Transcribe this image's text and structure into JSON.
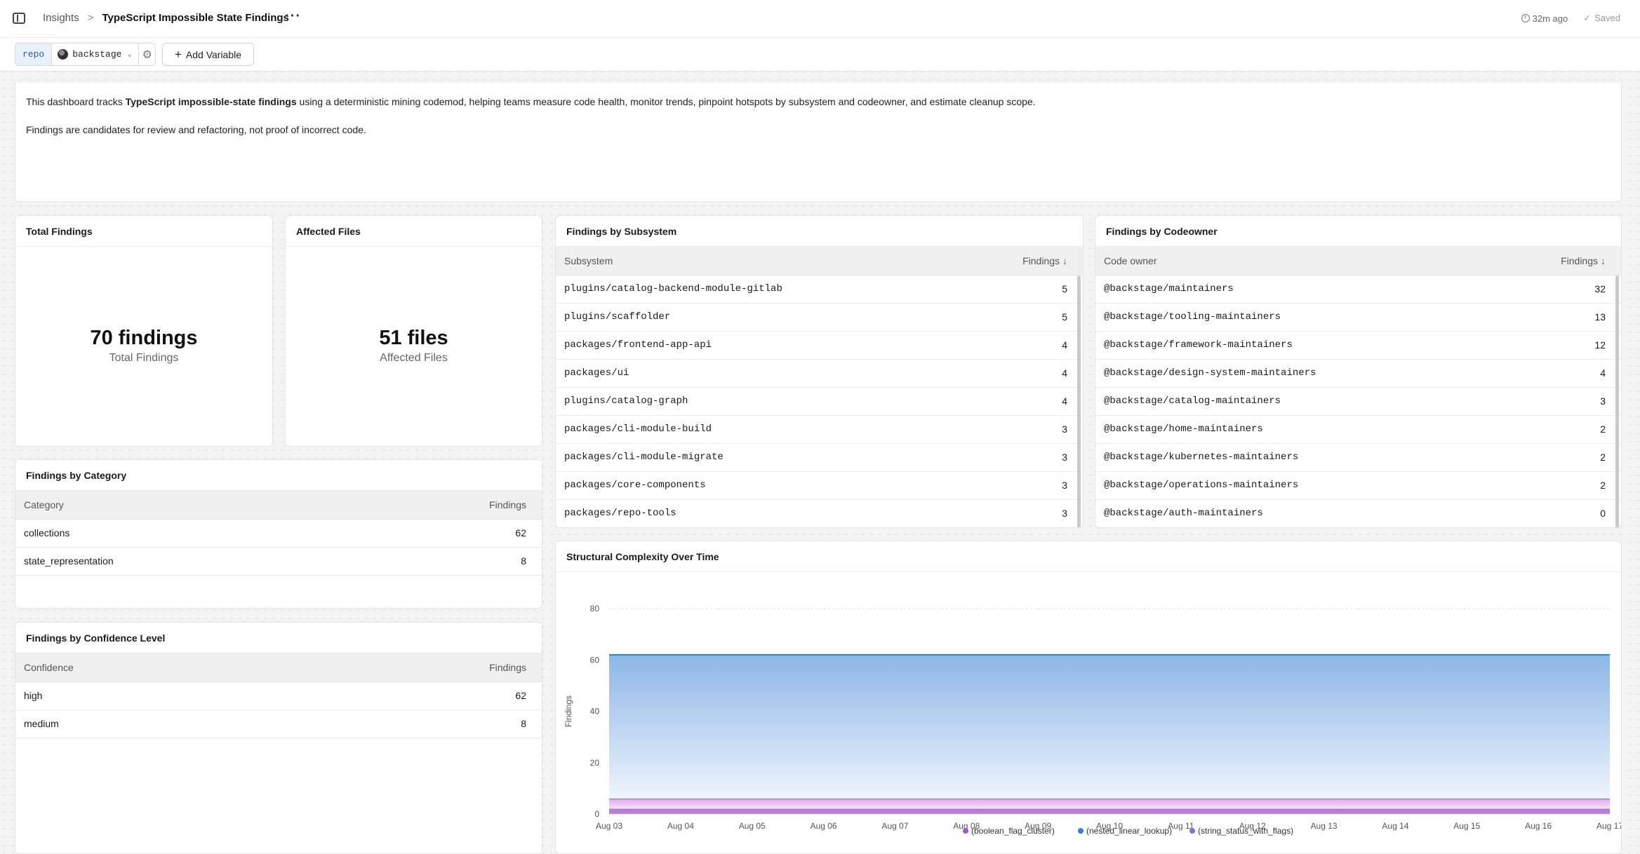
{
  "header": {
    "breadcrumb_root": "Insights",
    "breadcrumb_sep": ">",
    "title": "TypeScript Impossible State Findings",
    "more": "···",
    "updated": "32m ago",
    "saved": "Saved"
  },
  "variables": {
    "key": "repo",
    "value": "backstage",
    "add_label": "Add Variable"
  },
  "intro": {
    "line1_before": "This dashboard tracks ",
    "line1_bold": "TypeScript impossible-state findings",
    "line1_after": " using a deterministic mining codemod, helping teams measure code health, monitor trends, pinpoint hotspots by subsystem and codeowner, and estimate cleanup scope.",
    "line2": "Findings are candidates for review and refactoring, not proof of incorrect code."
  },
  "total_findings": {
    "title": "Total Findings",
    "value": "70 findings",
    "label": "Total Findings"
  },
  "affected_files": {
    "title": "Affected Files",
    "value": "51 files",
    "label": "Affected Files"
  },
  "by_subsystem": {
    "title": "Findings by Subsystem",
    "col_key": "Subsystem",
    "col_val": "Findings",
    "rows": [
      {
        "key": "plugins/catalog-backend-module-gitlab",
        "val": "5"
      },
      {
        "key": "plugins/scaffolder",
        "val": "5"
      },
      {
        "key": "packages/frontend-app-api",
        "val": "4"
      },
      {
        "key": "packages/ui",
        "val": "4"
      },
      {
        "key": "plugins/catalog-graph",
        "val": "4"
      },
      {
        "key": "packages/cli-module-build",
        "val": "3"
      },
      {
        "key": "packages/cli-module-migrate",
        "val": "3"
      },
      {
        "key": "packages/core-components",
        "val": "3"
      },
      {
        "key": "packages/repo-tools",
        "val": "3"
      }
    ]
  },
  "by_codeowner": {
    "title": "Findings by Codeowner",
    "col_key": "Code owner",
    "col_val": "Findings",
    "rows": [
      {
        "key": "@backstage/maintainers",
        "val": "32"
      },
      {
        "key": "@backstage/tooling-maintainers",
        "val": "13"
      },
      {
        "key": "@backstage/framework-maintainers",
        "val": "12"
      },
      {
        "key": "@backstage/design-system-maintainers",
        "val": "4"
      },
      {
        "key": "@backstage/catalog-maintainers",
        "val": "3"
      },
      {
        "key": "@backstage/home-maintainers",
        "val": "2"
      },
      {
        "key": "@backstage/kubernetes-maintainers",
        "val": "2"
      },
      {
        "key": "@backstage/operations-maintainers",
        "val": "2"
      },
      {
        "key": "@backstage/auth-maintainers",
        "val": "0"
      }
    ]
  },
  "by_category": {
    "title": "Findings by Category",
    "col_key": "Category",
    "col_val": "Findings",
    "rows": [
      {
        "key": "collections",
        "val": "62"
      },
      {
        "key": "state_representation",
        "val": "8"
      }
    ]
  },
  "by_confidence": {
    "title": "Findings by Confidence Level",
    "col_key": "Confidence",
    "col_val": "Findings",
    "rows": [
      {
        "key": "high",
        "val": "62"
      },
      {
        "key": "medium",
        "val": "8"
      }
    ]
  },
  "chart_data": {
    "type": "area",
    "title": "Structural Complexity Over Time",
    "xlabel": "",
    "ylabel": "Findings",
    "ylim": [
      0,
      80
    ],
    "yticks": [
      0,
      20,
      40,
      60,
      80
    ],
    "x": [
      "Aug 03",
      "Aug 04",
      "Aug 05",
      "Aug 06",
      "Aug 07",
      "Aug 08",
      "Aug 09",
      "Aug 10",
      "Aug 11",
      "Aug 12",
      "Aug 13",
      "Aug 14",
      "Aug 15",
      "Aug 16",
      "Aug 17"
    ],
    "stacked": true,
    "grid": true,
    "legend_position": "bottom",
    "series": [
      {
        "name": "(boolean_flag_cluster)",
        "color": "#a35bc9",
        "values": [
          2,
          2,
          2,
          2,
          2,
          2,
          2,
          2,
          2,
          2,
          2,
          2,
          2,
          2,
          2
        ]
      },
      {
        "name": "(nested_linear_lookup)",
        "color": "#2f7fd6",
        "values": [
          56,
          56,
          56,
          56,
          56,
          56,
          56,
          56,
          56,
          56,
          56,
          56,
          56,
          56,
          56
        ]
      },
      {
        "name": "(string_status_with_flags)",
        "color": "#8b6fd8",
        "values": [
          4,
          4,
          4,
          4,
          4,
          4,
          4,
          4,
          4,
          4,
          4,
          4,
          4,
          4,
          4
        ]
      }
    ]
  }
}
